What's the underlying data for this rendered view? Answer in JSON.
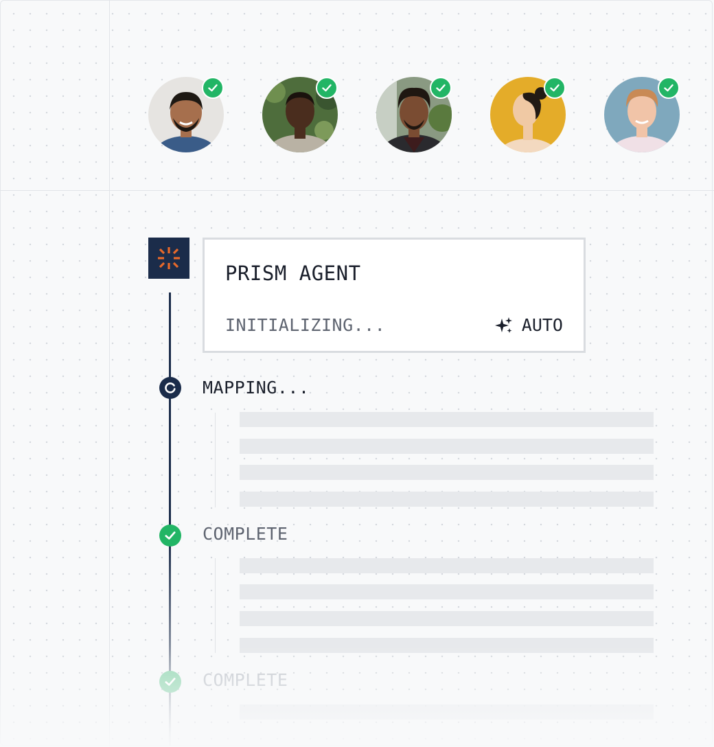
{
  "avatars": [
    {
      "name": "avatar-1",
      "bg": "#e6e4e1",
      "skin": "#a66f4d",
      "hair": "#1d1813",
      "shirt": "#3a5c88",
      "verified": true
    },
    {
      "name": "avatar-2",
      "bg": "#4e6d3c",
      "skin": "#4a2d1e",
      "hair": "#1a120d",
      "shirt": "#b9b2a4",
      "verified": true
    },
    {
      "name": "avatar-3",
      "bg": "#8a9a82",
      "skin": "#7a4c32",
      "hair": "#1f1711",
      "shirt": "#3d1c1d",
      "verified": true
    },
    {
      "name": "avatar-4",
      "bg": "#e4ac29",
      "skin": "#f0c9a4",
      "hair": "#221a14",
      "shirt": "#f3d9c0",
      "verified": true
    },
    {
      "name": "avatar-5",
      "bg": "#7fa8bd",
      "skin": "#f1c4a8",
      "hair": "#c98a55",
      "shirt": "#f0e0e6",
      "verified": true
    }
  ],
  "agent": {
    "title": "PRISM AGENT",
    "status": "INITIALIZING...",
    "mode": "AUTO",
    "mode_icon": "sparkle-icon",
    "logo_icon": "burst-logo-icon"
  },
  "steps": [
    {
      "label": "MAPPING...",
      "state": "in-progress",
      "icon": "spinner-icon",
      "placeholder_rows": 4
    },
    {
      "label": "COMPLETE",
      "state": "complete",
      "icon": "check-icon",
      "placeholder_rows": 4
    },
    {
      "label": "COMPLETE",
      "state": "complete-faded",
      "icon": "check-icon",
      "placeholder_rows": 1
    }
  ],
  "colors": {
    "navy": "#1b2c4a",
    "success": "#22b565",
    "accent_orange": "#e8692a",
    "placeholder": "#e7e9ec"
  }
}
